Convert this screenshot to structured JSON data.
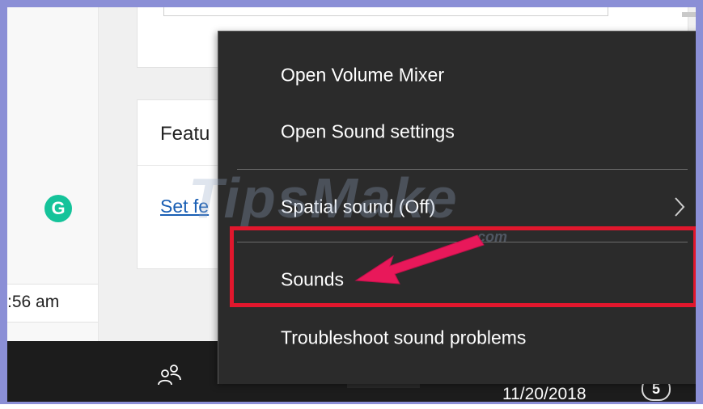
{
  "background_app": {
    "feature_card_title": "Featu",
    "feature_card_link": "Set fe",
    "grammarly_glyph": "G",
    "time_text": ":56 am"
  },
  "taskbar": {
    "date": "11/20/2018",
    "notification_count": "5"
  },
  "context_menu": {
    "items": [
      {
        "label": "Open Volume Mixer"
      },
      {
        "label": "Open Sound settings"
      },
      {
        "label": "Spatial sound (Off)",
        "has_submenu": true
      },
      {
        "label": "Sounds",
        "highlighted": true
      },
      {
        "label": "Troubleshoot sound problems"
      }
    ]
  },
  "watermark": {
    "text": "TipsMake",
    "suffix": ".com"
  },
  "colors": {
    "frame": "#8b8fd6",
    "menu_bg": "#2b2b2b",
    "highlight": "#e1172d",
    "arrow": "#e8185a",
    "grammarly": "#15c39a",
    "link": "#1a5fb4"
  },
  "icons": [
    "grammarly-icon",
    "people-icon",
    "chevron-right-icon",
    "arrow-annotation"
  ]
}
